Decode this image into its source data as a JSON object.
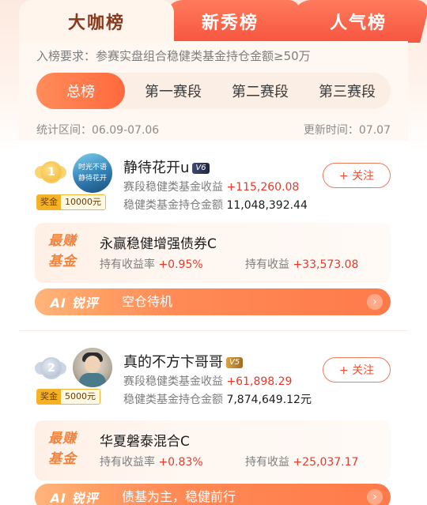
{
  "tabs": {
    "active": "大咖榜",
    "second": "新秀榜",
    "third": "人气榜"
  },
  "requirement": "入榜要求：参赛实盘组合稳健类基金持仓金额≥50万",
  "segments": [
    "总榜",
    "第一赛段",
    "第二赛段",
    "第三赛段"
  ],
  "stat_range": "统计区间：06.09-07.06",
  "update_time": "更新时间：07.07",
  "entries": [
    {
      "rank": "1",
      "medal": "gold",
      "bonus_tag": "奖金",
      "bonus_amount": "10000元",
      "avatar_text_1": "时光不语",
      "avatar_text_2": "静待花开",
      "name": "静待花开u",
      "vip_level": "6",
      "income_label": "赛段稳健类基金收益",
      "income_value": "+115,260.08",
      "holding_label": "稳健类基金持仓金额",
      "holding_value": "11,048,392.44",
      "follow_label": "+ 关注",
      "badge_line1": "最赚",
      "badge_line2": "基金",
      "fund_name": "永赢稳健增强债券C",
      "rate_label": "持有收益率",
      "rate_value": "+0.95%",
      "profit_label": "持有收益",
      "profit_value": "+33,573.08",
      "ai_label": "AI 锐评",
      "ai_text": "空仓待机",
      "ai_arrow": "›"
    },
    {
      "rank": "2",
      "medal": "silver",
      "bonus_tag": "奖金",
      "bonus_amount": "5000元",
      "name": "真的不方卞哥哥",
      "vip_level": "5",
      "income_label": "赛段稳健类基金收益",
      "income_value": "+61,898.29",
      "holding_label": "稳健类基金持仓金额",
      "holding_value": "7,874,649.12元",
      "follow_label": "+ 关注",
      "badge_line1": "最赚",
      "badge_line2": "基金",
      "fund_name": "华夏磐泰混合C",
      "rate_label": "持有收益率",
      "rate_value": "+0.83%",
      "profit_label": "持有收益",
      "profit_value": "+25,037.17",
      "ai_label": "AI 锐评",
      "ai_text": "债基为主，稳健前行",
      "ai_arrow": "›"
    }
  ],
  "colors": {
    "accent": "#ff6a3e",
    "positive": "#e23b2e",
    "tab_inactive": "#f6563f"
  }
}
